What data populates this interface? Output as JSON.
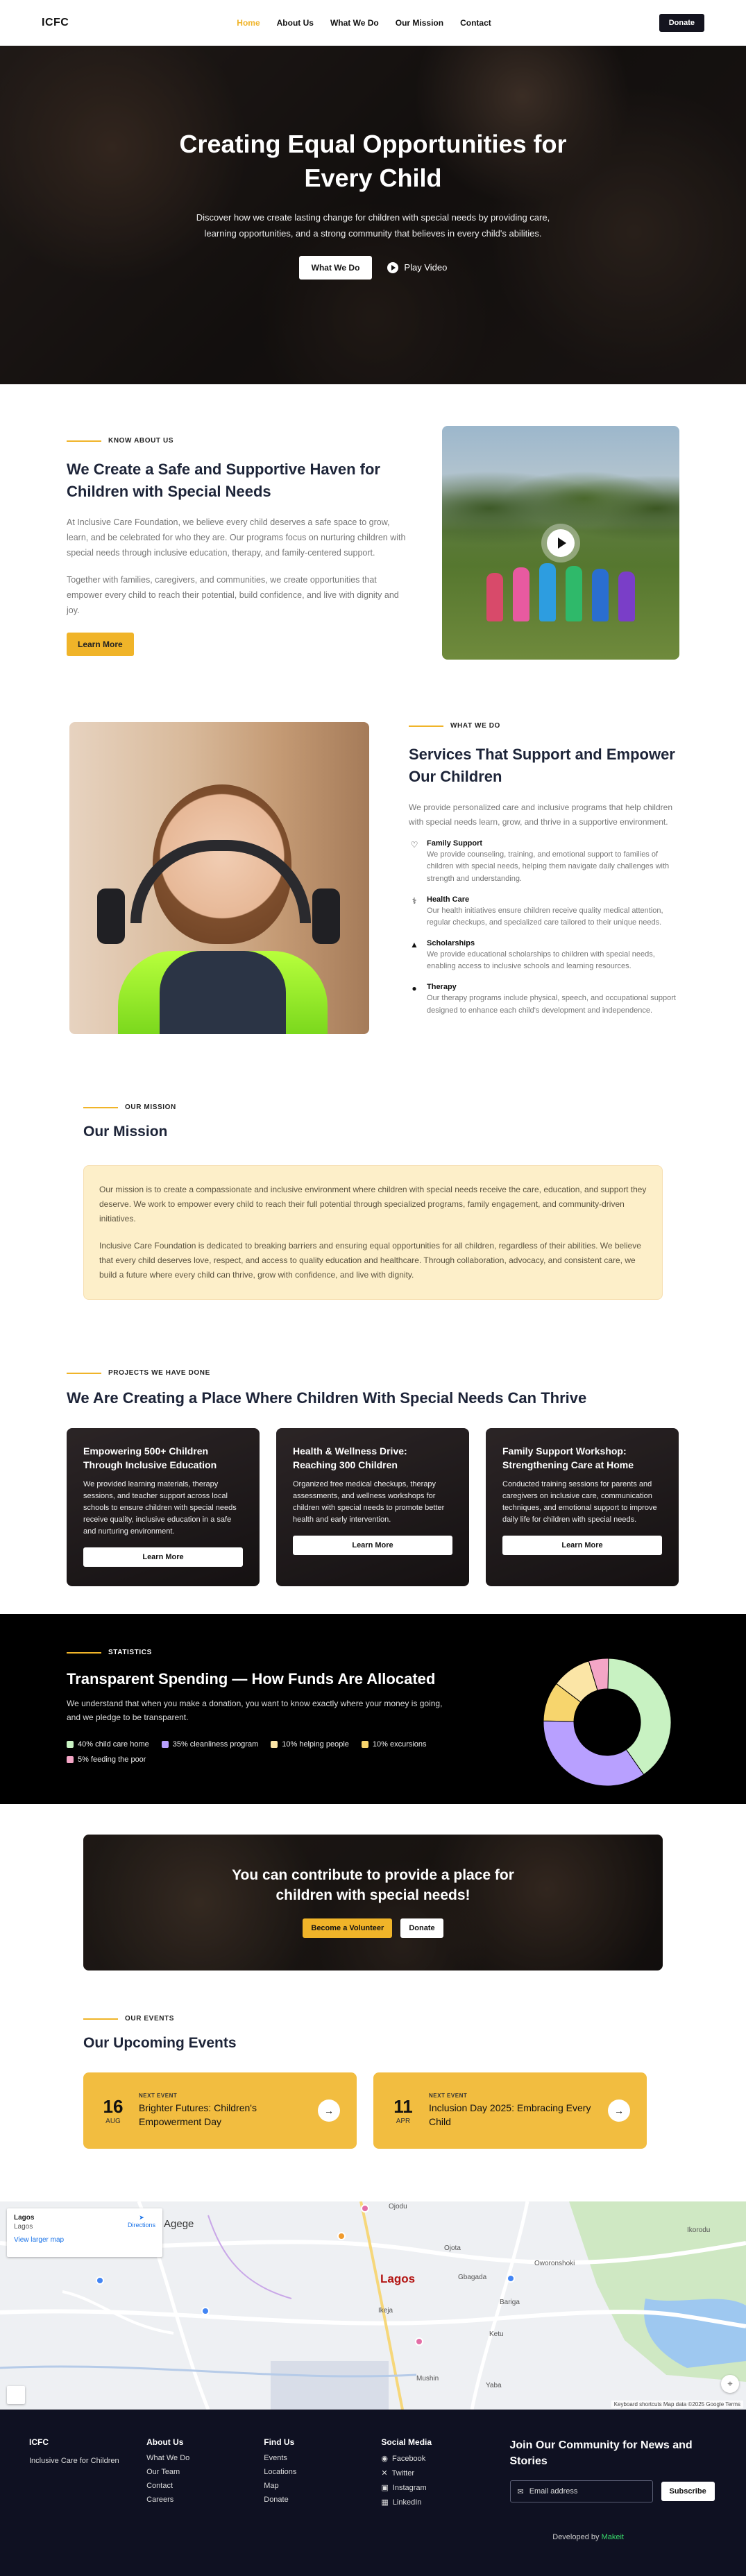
{
  "header": {
    "logo": "ICFC",
    "nav": [
      "Home",
      "About Us",
      "What We Do",
      "Our Mission",
      "Contact"
    ],
    "donate": "Donate"
  },
  "hero": {
    "title": "Creating Equal Opportunities for Every Child",
    "subtitle": "Discover how we create lasting change for children with special needs by providing care, learning opportunities, and a strong community that believes in every child's abilities.",
    "primary_btn": "What We Do",
    "video_label": "Play Video"
  },
  "about": {
    "eyebrow": "KNOW ABOUT US",
    "title": "We Create a Safe and Supportive Haven for Children with Special Needs",
    "p1": "At Inclusive Care Foundation, we believe every child deserves a safe space to grow, learn, and be celebrated for who they are. Our programs focus on nurturing children with special needs through inclusive education, therapy, and family-centered support.",
    "p2": "Together with families, caregivers, and communities, we create opportunities that empower every child to reach their potential, build confidence, and live with dignity and joy.",
    "cta": "Learn More"
  },
  "services": {
    "eyebrow": "WHAT WE DO",
    "title": "Services That Support and Empower Our Children",
    "lead": "We provide personalized care and inclusive programs that help children with special needs learn, grow, and thrive in a supportive environment.",
    "items": [
      {
        "icon": "handshake-heart-icon",
        "title": "Family Support",
        "text": "We provide counseling, training, and emotional support to families of children with special needs, helping them navigate daily challenges with strength and understanding."
      },
      {
        "icon": "health-hand-icon",
        "title": "Health Care",
        "text": "Our health initiatives ensure children receive quality medical attention, regular checkups, and specialized care tailored to their unique needs."
      },
      {
        "icon": "graduation-cap-icon",
        "title": "Scholarships",
        "text": "We provide educational scholarships to children with special needs, enabling access to inclusive schools and learning resources."
      },
      {
        "icon": "therapy-icon",
        "title": "Therapy",
        "text": "Our therapy programs include physical, speech, and occupational support designed to enhance each child's development and independence."
      }
    ]
  },
  "mission": {
    "eyebrow": "OUR MISSION",
    "title": "Our Mission",
    "p1": "Our mission is to create a compassionate and inclusive environment where children with special needs receive the care, education, and support they deserve. We work to empower every child to reach their full potential through specialized programs, family engagement, and community-driven initiatives.",
    "p2": "Inclusive Care Foundation is dedicated to breaking barriers and ensuring equal opportunities for all children, regardless of their abilities. We believe that every child deserves love, respect, and access to quality education and healthcare. Through collaboration, advocacy, and consistent care, we build a future where every child can thrive, grow with confidence, and live with dignity."
  },
  "projects": {
    "eyebrow": "PROJECTS WE HAVE DONE",
    "title": "We Are Creating a Place Where Children With Special Needs Can Thrive",
    "cards": [
      {
        "title": "Empowering 500+ Children Through Inclusive Education",
        "text": "We provided learning materials, therapy sessions, and teacher support across local schools to ensure children with special needs receive quality, inclusive education in a safe and nurturing environment.",
        "btn": "Learn More"
      },
      {
        "title": "Health & Wellness Drive: Reaching 300 Children",
        "text": "Organized free medical checkups, therapy assessments, and wellness workshops for children with special needs to promote better health and early intervention.",
        "btn": "Learn More"
      },
      {
        "title": "Family Support Workshop: Strengthening Care at Home",
        "text": "Conducted training sessions for parents and caregivers on inclusive care, communication techniques, and emotional support to improve daily life for children with special needs.",
        "btn": "Learn More"
      }
    ]
  },
  "stats": {
    "eyebrow": "STATISTICS",
    "title": "Transparent Spending — How Funds Are Allocated",
    "text": "We understand that when you make a donation, you want to know exactly where your money is going, and we pledge to be transparent."
  },
  "chart_data": {
    "type": "pie",
    "donut": true,
    "categories": [
      "40% child care home",
      "35% cleanliness program",
      "10% helping people",
      "10% excursions",
      "5% feeding the poor"
    ],
    "values": [
      40,
      35,
      10,
      10,
      5
    ],
    "colors": [
      "#c8f2c2",
      "#b8a0ff",
      "#fbe5a6",
      "#f7d56d",
      "#f4a6c6"
    ]
  },
  "cta": {
    "title": "You can contribute to provide a place for children with special needs!",
    "volunteer": "Become a Volunteer",
    "donate": "Donate"
  },
  "events": {
    "eyebrow": "OUR EVENTS",
    "title": "Our Upcoming Events",
    "items": [
      {
        "day": "16",
        "month": "AUG",
        "tag": "NEXT EVENT",
        "title": "Brighter Futures: Children's Empowerment Day"
      },
      {
        "day": "11",
        "month": "APR",
        "tag": "NEXT EVENT",
        "title": "Inclusion Day 2025: Embracing Every Child"
      }
    ]
  },
  "map": {
    "place": "Lagos",
    "subtitle": "Lagos",
    "link": "View larger map",
    "directions": "Directions",
    "city_label": "Lagos",
    "labels": [
      "Ojodu",
      "Ikeja",
      "Agege",
      "Ketu",
      "Oworonshoki",
      "Gbagada",
      "Bariga",
      "Yaba",
      "Mushin",
      "Ojota",
      "Ikorodu"
    ],
    "attribution": "Keyboard shortcuts   Map data ©2025 Google   Terms"
  },
  "footer": {
    "brand": "ICFC",
    "tagline": "Inclusive Care for Children",
    "cols": [
      {
        "title": "About Us",
        "links": [
          "What We Do",
          "Our Team",
          "Contact",
          "Careers"
        ]
      },
      {
        "title": "Find Us",
        "links": [
          "Events",
          "Locations",
          "Map",
          "Donate"
        ]
      },
      {
        "title": "Social Media",
        "links": [
          "Facebook",
          "Twitter",
          "Instagram",
          "LinkedIn"
        ]
      }
    ],
    "social_icons": [
      "facebook-icon",
      "x-icon",
      "instagram-icon",
      "linkedin-icon"
    ],
    "newsletter_title": "Join Our Community for News and Stories",
    "email_placeholder": "Email address",
    "subscribe": "Subscribe",
    "developed_by": "Developed by",
    "developer": "Makeit"
  }
}
